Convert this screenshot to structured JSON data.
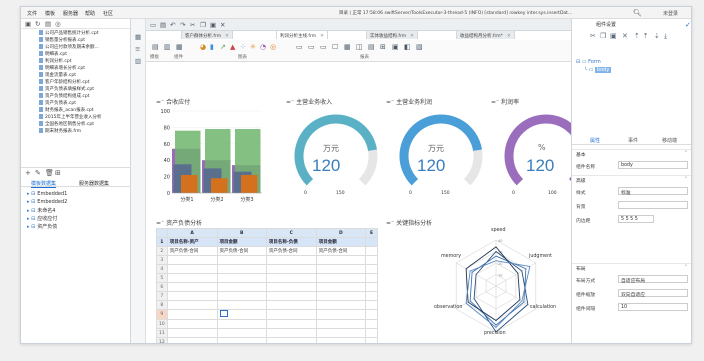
{
  "menu": [
    "文件",
    "模板",
    "服务器",
    "帮助",
    "社区"
  ],
  "window_title": "目录 | 正常 17:58:06 swiftServer/ToolsExecutor-3-thread-5 (INFO) [standard] rowkey inter.sys.insertDat...",
  "user": "未登录",
  "left_files": [
    "公司产品销售统计分析.cpt",
    "销售量分析报表.cpt",
    "公司应付款项及期末余额...",
    "明细表.cpt",
    "利润分析.cpt",
    "明细表增长分析.cpt",
    "现金流量表.cpt",
    "客户年龄结构分析.cpt",
    "资产负债表填报样式.cpt",
    "资产负债结构组成.cpt",
    "资产负债表.cpt",
    "财务报表_acan报表.cpt",
    "2015年上半年营业收入分析",
    "全国各地区销售分析.cpt",
    "期末财务报表.frm"
  ],
  "left_tabs": [
    "模板数据集",
    "服务器数据集"
  ],
  "datasets": [
    "Embedded1",
    "Embedded2",
    "未命名4",
    "应收应付",
    "资产负债"
  ],
  "doc_tabs": [
    {
      "label": "客户群体分析.frm"
    },
    {
      "label": "利润分析主线.frm",
      "active": true
    },
    {
      "label": "实体收益结构.frm"
    },
    {
      "label": "收益结构月分析.frm*"
    }
  ],
  "ribbon_labels": [
    "模板",
    "组件",
    "图表",
    "报表"
  ],
  "panels": {
    "p1": "合收应付",
    "p2": "主营业务收入",
    "p3": "主营业务利润",
    "p4": "利润率",
    "p5": "资产负债分析",
    "p6": "关键指标分析"
  },
  "gauges": [
    {
      "unit": "万元",
      "value": "120",
      "min": "0",
      "max": "150"
    },
    {
      "unit": "万元",
      "value": "120",
      "min": "0",
      "max": "150"
    },
    {
      "unit": "%",
      "value": "120",
      "min": "0",
      "max": "100"
    }
  ],
  "colors": {
    "gauge_teal": "#5ab0c4",
    "gauge_blue": "#4a9fd9",
    "gauge_purple": "#9b6dbd",
    "gauge_track": "#e6e6e6",
    "bar_green": "#6fb56c",
    "bar_orange": "#d4711f",
    "bar_steel": "#5a6f8d",
    "bar_purple": "#9a6bb8",
    "bar_blue": "#3f74b3"
  },
  "chart_data": [
    {
      "type": "bar",
      "title": "合收应付",
      "categories": [
        "分类1",
        "分类2",
        "分类3"
      ],
      "series": [
        {
          "values": [
            54,
            40,
            34
          ]
        },
        {
          "values": [
            76,
            78,
            78
          ]
        },
        {
          "values": [
            35,
            30,
            26
          ]
        },
        {
          "values": [
            22,
            18,
            22
          ]
        }
      ],
      "ylim": [
        0,
        100
      ],
      "yticks": [
        0,
        20,
        40,
        60,
        80,
        100
      ]
    },
    {
      "type": "radar",
      "title": "关键指标分析",
      "axes": [
        "speed",
        "judgment",
        "calculation",
        "precision",
        "observation",
        "memory"
      ],
      "rticks": [
        0,
        10,
        20,
        30,
        40
      ],
      "series": [
        {
          "values": [
            30,
            26,
            32,
            40,
            22,
            20
          ]
        },
        {
          "values": [
            26,
            30,
            28,
            34,
            26,
            24
          ]
        },
        {
          "values": [
            34,
            22,
            24,
            30,
            28,
            30
          ]
        },
        {
          "values": [
            22,
            34,
            26,
            36,
            30,
            26
          ]
        }
      ]
    }
  ],
  "sheet": {
    "col_headers": [
      "",
      "A",
      "B",
      "C",
      "D",
      "E"
    ],
    "header_row": [
      "项目名称-资产",
      "项目金额",
      "项目名称-负债",
      "项目金额"
    ],
    "row2": [
      "资产负债-合同",
      "资产负债-合同",
      "资产负债-合同",
      "资产负债-合同"
    ],
    "rows": [
      "1",
      "2",
      "3",
      "4",
      "5",
      "6",
      "7",
      "8",
      "9",
      "10",
      "11",
      "12",
      "13"
    ]
  },
  "right_panel": {
    "title": "组件设置",
    "tree": [
      "Form",
      "body"
    ],
    "tabs": [
      "属性",
      "事件",
      "移动端"
    ],
    "sections": [
      "基本",
      "高级"
    ],
    "props": [
      {
        "label": "组件名称",
        "value": "body"
      },
      {
        "label": "样式",
        "value": "标准"
      },
      {
        "label": "背景",
        "value": ""
      },
      {
        "label": "内边距",
        "value": "5 5 5 5"
      }
    ],
    "layout_section": "布局",
    "layout_props": [
      {
        "label": "布局方式",
        "value": "自适应布局"
      },
      {
        "label": "组件缩放",
        "value": "双向自适应"
      },
      {
        "label": "组件间隔",
        "value": "10"
      }
    ]
  }
}
